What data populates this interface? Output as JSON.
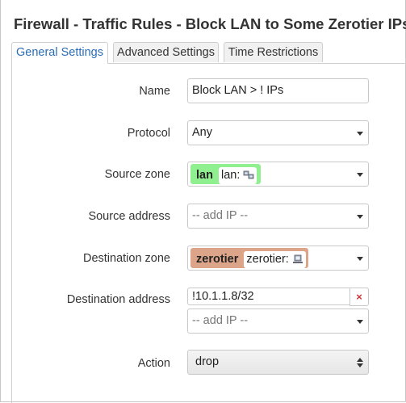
{
  "title": "Firewall - Traffic Rules - Block LAN to Some Zerotier IPs",
  "tabs": [
    {
      "label": "General Settings",
      "active": true
    },
    {
      "label": "Advanced Settings",
      "active": false
    },
    {
      "label": "Time Restrictions",
      "active": false
    }
  ],
  "form": {
    "name": {
      "label": "Name",
      "value": "Block LAN > ! IPs"
    },
    "protocol": {
      "label": "Protocol",
      "value": "Any"
    },
    "source_zone": {
      "label": "Source zone",
      "zone": "lan",
      "iface": "lan:",
      "color": "#90f090",
      "icon": "network-interfaces-icon"
    },
    "source_address": {
      "label": "Source address",
      "placeholder": "-- add IP --"
    },
    "destination_zone": {
      "label": "Destination zone",
      "zone": "zerotier",
      "iface": "zerotier:",
      "color": "#dca58a",
      "icon": "network-interface-icon"
    },
    "destination_address": {
      "label": "Destination address",
      "value": "!10.1.1.8/32",
      "remove_label": "×",
      "placeholder": "-- add IP --"
    },
    "action": {
      "label": "Action",
      "value": "drop"
    }
  },
  "colors": {
    "accent": "#2a6db3",
    "remove": "#cc3333"
  }
}
